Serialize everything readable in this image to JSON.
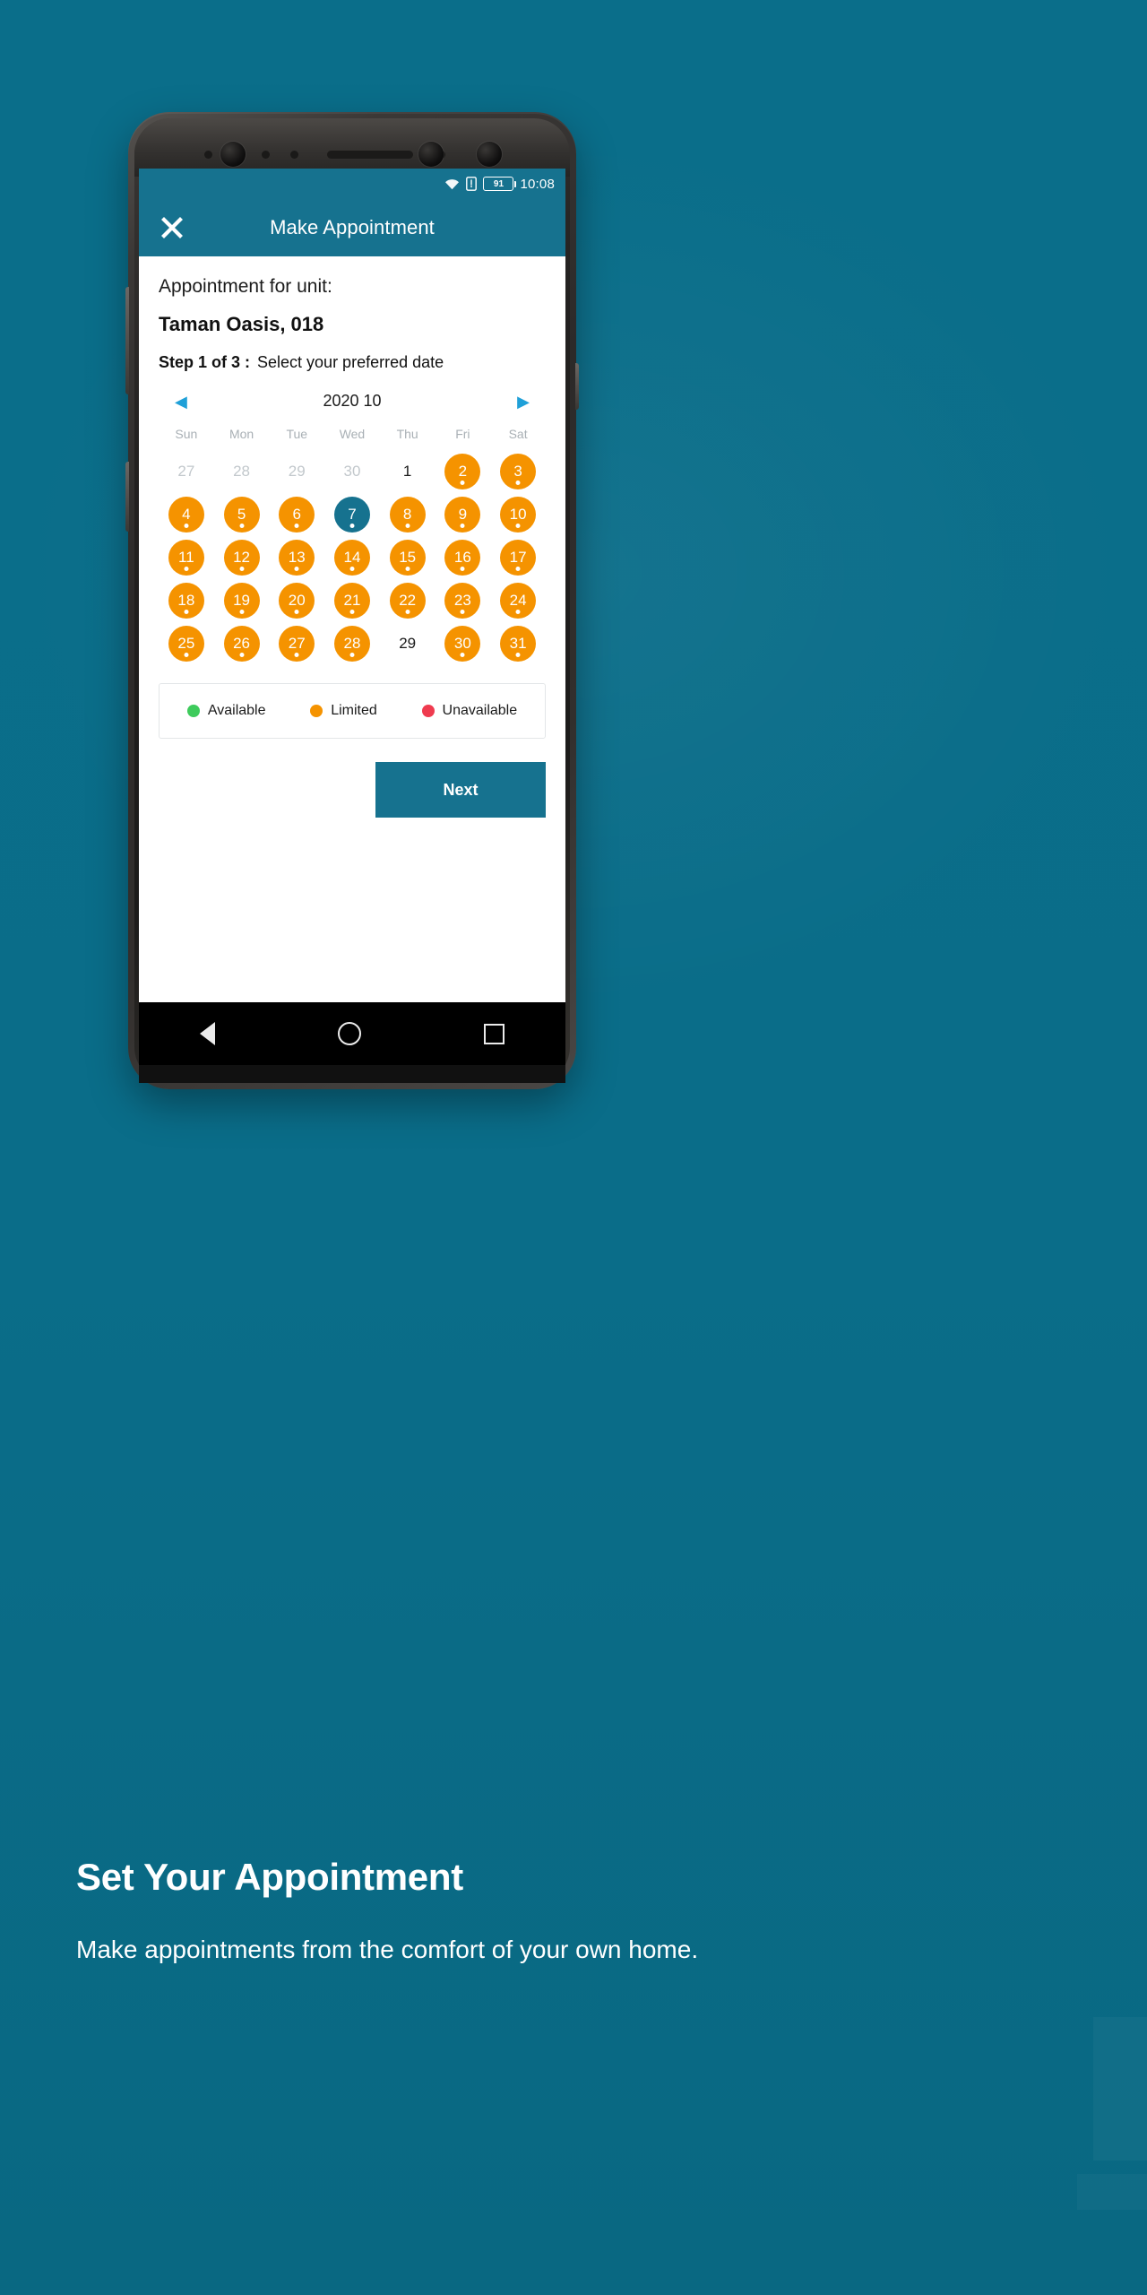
{
  "background": {
    "color": "#0a6e8a"
  },
  "statusbar": {
    "time": "10:08",
    "battery_percent": "91",
    "icons": [
      "wifi-icon",
      "sim-card-icon",
      "battery-icon"
    ]
  },
  "appbar": {
    "close_label": "✕",
    "title": "Make Appointment",
    "bg": "#16728f"
  },
  "screen": {
    "lead": "Appointment for unit:",
    "unit": "Taman Oasis, 018",
    "step_label": "Step 1 of 3 :",
    "step_desc": "Select your preferred date"
  },
  "calendar": {
    "prev_icon": "◀",
    "next_icon": "▶",
    "month_label": "2020 10",
    "weekdays": [
      "Sun",
      "Mon",
      "Tue",
      "Wed",
      "Thu",
      "Fri",
      "Sat"
    ],
    "weeks": [
      [
        {
          "day": "27",
          "state": "muted"
        },
        {
          "day": "28",
          "state": "muted"
        },
        {
          "day": "29",
          "state": "muted"
        },
        {
          "day": "30",
          "state": "muted"
        },
        {
          "day": "1",
          "state": "plain"
        },
        {
          "day": "2",
          "state": "limited"
        },
        {
          "day": "3",
          "state": "limited"
        }
      ],
      [
        {
          "day": "4",
          "state": "limited"
        },
        {
          "day": "5",
          "state": "limited"
        },
        {
          "day": "6",
          "state": "limited"
        },
        {
          "day": "7",
          "state": "selected"
        },
        {
          "day": "8",
          "state": "limited"
        },
        {
          "day": "9",
          "state": "limited"
        },
        {
          "day": "10",
          "state": "limited"
        }
      ],
      [
        {
          "day": "11",
          "state": "limited"
        },
        {
          "day": "12",
          "state": "limited"
        },
        {
          "day": "13",
          "state": "limited"
        },
        {
          "day": "14",
          "state": "limited"
        },
        {
          "day": "15",
          "state": "limited"
        },
        {
          "day": "16",
          "state": "limited"
        },
        {
          "day": "17",
          "state": "limited"
        }
      ],
      [
        {
          "day": "18",
          "state": "limited"
        },
        {
          "day": "19",
          "state": "limited"
        },
        {
          "day": "20",
          "state": "limited"
        },
        {
          "day": "21",
          "state": "limited"
        },
        {
          "day": "22",
          "state": "limited"
        },
        {
          "day": "23",
          "state": "limited"
        },
        {
          "day": "24",
          "state": "limited"
        }
      ],
      [
        {
          "day": "25",
          "state": "limited"
        },
        {
          "day": "26",
          "state": "limited"
        },
        {
          "day": "27",
          "state": "limited"
        },
        {
          "day": "28",
          "state": "limited"
        },
        {
          "day": "29",
          "state": "plain"
        },
        {
          "day": "30",
          "state": "limited"
        },
        {
          "day": "31",
          "state": "limited"
        }
      ]
    ]
  },
  "legend": [
    {
      "label": "Available",
      "color": "#3ecb5c"
    },
    {
      "label": "Limited",
      "color": "#f59300"
    },
    {
      "label": "Unavailable",
      "color": "#ef3b4f"
    }
  ],
  "actions": {
    "next_label": "Next"
  },
  "navbar": {
    "back": "back-triangle-icon",
    "home": "home-circle-icon",
    "recents": "recents-square-icon"
  },
  "caption": {
    "title": "Set Your Appointment",
    "body": "Make appointments from the comfort of your own home."
  }
}
